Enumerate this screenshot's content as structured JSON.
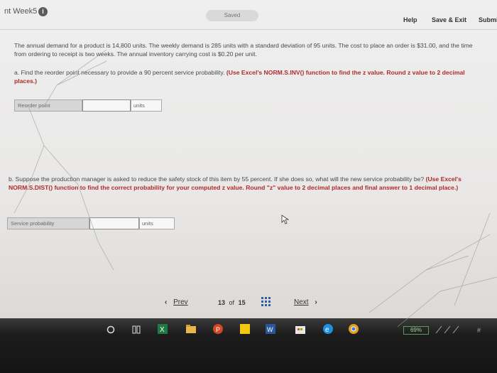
{
  "header": {
    "week_label": "nt Week5",
    "saved": "Saved",
    "help": "Help",
    "save_exit": "Save & Exit",
    "submit": "Submi"
  },
  "problem": {
    "intro": "The annual demand for a product is 14,800 units. The weekly demand is 285 units with a standard deviation of 95 units. The cost to place an order is $31.00, and the time from ordering to receipt is two weeks. The annual inventory carrying cost is $0.20 per unit.",
    "part_a_text": "a. Find the reorder point necessary to provide a 90 percent service probability.",
    "part_a_hint": "(Use Excel's NORM.S.INV() function to find the z value. Round z value to 2 decimal places.)",
    "reorder_label": "Reorder point",
    "reorder_units": "units",
    "reorder_value": "",
    "part_b_text": "b. Suppose the production manager is asked to reduce the safety stock of this item by 55 percent. If she does so, what will the new service probability be?",
    "part_b_hint": "(Use Excel's NORM.S.DIST() function to find the correct probability for your computed z value. Round \"z\" value to 2 decimal places and final answer to 1 decimal place.)",
    "service_label": "Service probability",
    "service_units": "units",
    "service_value": ""
  },
  "pager": {
    "prev": "Prev",
    "current": "13",
    "of": "of",
    "total": "15",
    "next": "Next"
  },
  "taskbar": {
    "battery": "69%"
  }
}
